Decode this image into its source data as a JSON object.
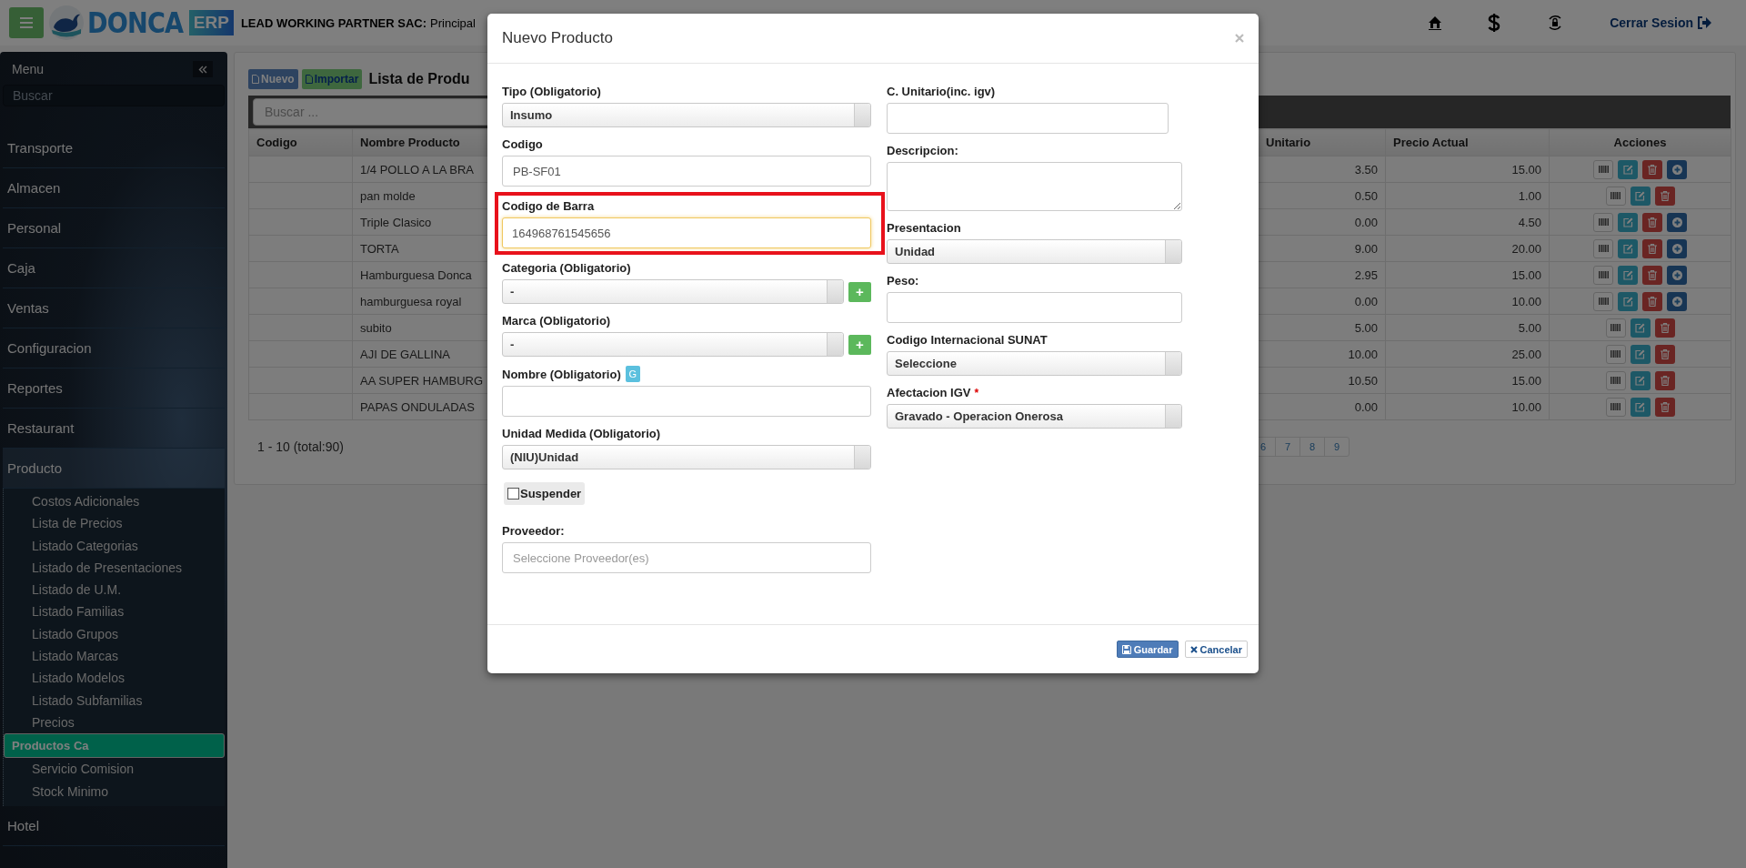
{
  "header": {
    "brand": "DONCA",
    "brand_badge": "ERP",
    "company": "LEAD WORKING PARTNER SAC:",
    "branch": "Principal",
    "logout": "Cerrar Sesion"
  },
  "sidebar": {
    "title": "Menu",
    "search_placeholder": "Buscar",
    "items": [
      {
        "label": "Transporte",
        "expanded": false
      },
      {
        "label": "Almacen",
        "expanded": false
      },
      {
        "label": "Personal",
        "expanded": false
      },
      {
        "label": "Caja",
        "expanded": false
      },
      {
        "label": "Ventas",
        "expanded": false
      },
      {
        "label": "Configuracion",
        "expanded": false
      },
      {
        "label": "Reportes",
        "expanded": false
      },
      {
        "label": "Restaurant",
        "expanded": false
      },
      {
        "label": "Producto",
        "expanded": true,
        "children": [
          {
            "label": "Costos Adicionales",
            "selected": false
          },
          {
            "label": "Lista de Precios",
            "selected": false
          },
          {
            "label": "Listado Categorias",
            "selected": false
          },
          {
            "label": "Listado de Presentaciones",
            "selected": false
          },
          {
            "label": "Listado de U.M.",
            "selected": false
          },
          {
            "label": "Listado Familias",
            "selected": false
          },
          {
            "label": "Listado Grupos",
            "selected": false
          },
          {
            "label": "Listado Marcas",
            "selected": false
          },
          {
            "label": "Listado Modelos",
            "selected": false
          },
          {
            "label": "Listado Subfamilias",
            "selected": false
          },
          {
            "label": "Precios",
            "selected": false
          },
          {
            "label": "Productos Ca",
            "selected": true
          },
          {
            "label": "Servicio Comision",
            "selected": false
          },
          {
            "label": "Stock Minimo",
            "selected": false
          }
        ]
      },
      {
        "label": "Hotel",
        "expanded": false
      }
    ]
  },
  "content": {
    "buttons": [
      {
        "label": "Nuevo",
        "kind": "primary"
      },
      {
        "label": "Importar",
        "kind": "success"
      }
    ],
    "title": "Lista de Produ",
    "search_placeholder": "Buscar ...",
    "table": {
      "columns": [
        "Codigo",
        "Nombre Producto",
        "Unitario",
        "Precio Actual",
        "Acciones"
      ],
      "rows": [
        {
          "name": "1/4 POLLO A LA BRA",
          "unit_cost": "3.50",
          "price": "15.00",
          "actions": [
            {
              "kind": "barcode"
            },
            {
              "kind": "edit"
            },
            {
              "kind": "delete"
            },
            {
              "kind": "add"
            }
          ]
        },
        {
          "name": "pan molde",
          "unit_cost": "0.50",
          "price": "1.00",
          "actions": [
            {
              "kind": "barcode"
            },
            {
              "kind": "edit"
            },
            {
              "kind": "delete"
            }
          ]
        },
        {
          "name": "Triple Clasico",
          "unit_cost": "0.00",
          "price": "4.50",
          "actions": [
            {
              "kind": "barcode"
            },
            {
              "kind": "edit"
            },
            {
              "kind": "delete"
            },
            {
              "kind": "add"
            }
          ]
        },
        {
          "name": "TORTA",
          "unit_cost": "9.00",
          "price": "20.00",
          "actions": [
            {
              "kind": "barcode"
            },
            {
              "kind": "edit"
            },
            {
              "kind": "delete"
            },
            {
              "kind": "add"
            }
          ]
        },
        {
          "name": "Hamburguesa Donca",
          "unit_cost": "2.95",
          "price": "15.00",
          "actions": [
            {
              "kind": "barcode"
            },
            {
              "kind": "edit"
            },
            {
              "kind": "delete"
            },
            {
              "kind": "add"
            }
          ]
        },
        {
          "name": "hamburguesa royal",
          "unit_cost": "0.00",
          "price": "10.00",
          "actions": [
            {
              "kind": "barcode"
            },
            {
              "kind": "edit"
            },
            {
              "kind": "delete"
            },
            {
              "kind": "add"
            }
          ]
        },
        {
          "name": "subito",
          "unit_cost": "5.00",
          "price": "5.00",
          "actions": [
            {
              "kind": "barcode"
            },
            {
              "kind": "edit"
            },
            {
              "kind": "delete"
            }
          ]
        },
        {
          "name": "AJI DE GALLINA",
          "unit_cost": "10.00",
          "price": "25.00",
          "actions": [
            {
              "kind": "barcode"
            },
            {
              "kind": "edit"
            },
            {
              "kind": "delete"
            }
          ]
        },
        {
          "name": "AA SUPER HAMBURG",
          "unit_cost": "10.50",
          "price": "15.00",
          "actions": [
            {
              "kind": "barcode"
            },
            {
              "kind": "edit"
            },
            {
              "kind": "delete"
            }
          ]
        },
        {
          "name": "PAPAS ONDULADAS",
          "unit_cost": "0.00",
          "price": "10.00",
          "actions": [
            {
              "kind": "barcode"
            },
            {
              "kind": "edit"
            },
            {
              "kind": "delete"
            }
          ]
        }
      ]
    },
    "pagination": {
      "summary": "1 - 10 (total:90)",
      "pages": [
        "6",
        "7",
        "8",
        "9"
      ]
    }
  },
  "modal": {
    "title": "Nuevo Producto",
    "left_fields": [
      {
        "kind": "select",
        "label": "Tipo (Obligatorio)",
        "value": "Insumo"
      },
      {
        "kind": "input",
        "label": "Codigo",
        "value": "PB-SF01"
      },
      {
        "kind": "input",
        "label": "Codigo de Barra",
        "value": "164968761545656",
        "focused": true,
        "highlighted": true
      },
      {
        "kind": "select_add",
        "label": "Categoria (Obligatorio)",
        "value": "-",
        "add": "+"
      },
      {
        "kind": "select_add",
        "label": "Marca (Obligatorio)",
        "value": "-",
        "add": "+"
      },
      {
        "kind": "input",
        "label": "Nombre (Obligatorio)",
        "badge": "G"
      },
      {
        "kind": "select",
        "label": "Unidad Medida (Obligatorio)",
        "value": "(NIU)Unidad"
      },
      {
        "kind": "checkbox",
        "label": "Suspender",
        "checked": false
      },
      {
        "kind": "input",
        "label": "Proveedor:",
        "placeholder": "Seleccione Proveedor(es)"
      }
    ],
    "right_fields": [
      {
        "kind": "input",
        "label": "C. Unitario(inc. igv)"
      },
      {
        "kind": "textarea",
        "label": "Descripcion:"
      },
      {
        "kind": "select",
        "label": "Presentacion",
        "value": "Unidad"
      },
      {
        "kind": "input",
        "label": "Peso:"
      },
      {
        "kind": "select",
        "label": "Codigo Internacional SUNAT",
        "value": "Seleccione"
      },
      {
        "kind": "select",
        "label": "Afectacion IGV",
        "required_mark": "*",
        "value": "Gravado - Operacion Onerosa"
      }
    ],
    "buttons": [
      {
        "label": "Guardar",
        "kind": "primary"
      },
      {
        "label": "Cancelar",
        "kind": "default"
      }
    ]
  }
}
